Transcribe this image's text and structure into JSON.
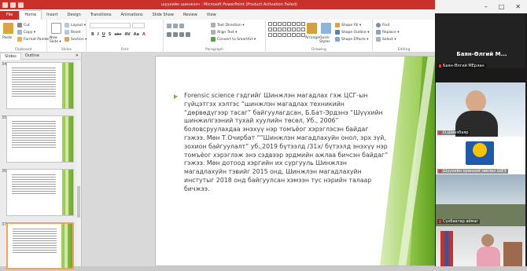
{
  "window": {
    "title": "шуухийн шинжээч - Microsoft PowerPoint (Product Activation Failed)",
    "top_controls": [
      "–",
      "□",
      "✕"
    ]
  },
  "ribbon": {
    "tabs": [
      "File",
      "Home",
      "Insert",
      "Design",
      "Transitions",
      "Animations",
      "Slide Show",
      "Review",
      "View"
    ],
    "clipboard": {
      "paste": "Paste",
      "cut": "Cut",
      "copy": "Copy ▾",
      "format_painter": "Format Painter",
      "label": "Clipboard"
    },
    "slides": {
      "new_slide": "New Slide ▾",
      "layout": "Layout ▾",
      "reset": "Reset",
      "section": "Section ▾",
      "label": "Slides"
    },
    "font": {
      "label": "Font",
      "buttons": [
        "B",
        "I",
        "U",
        "S",
        "abc",
        "AV",
        "Aa",
        "A"
      ]
    },
    "paragraph": {
      "text_direction": "Text Direction ▾",
      "align_text": "Align Text ▾",
      "convert": "Convert to SmartArt ▾",
      "label": "Paragraph"
    },
    "drawing": {
      "arrange": "Arrange",
      "quick_styles": "Quick Styles",
      "shape_fill": "Shape Fill ▾",
      "shape_outline": "Shape Outline ▾",
      "shape_effects": "Shape Effects ▾",
      "label": "Drawing"
    },
    "editing": {
      "find": "Find",
      "replace": "Replace ▾",
      "select": "Select ▾",
      "label": "Editing"
    }
  },
  "slides_pane": {
    "tabs": [
      "Slides",
      "Outline"
    ],
    "close": "✕",
    "thumbnails": [
      {
        "number": "34"
      },
      {
        "number": "35"
      },
      {
        "number": "36"
      },
      {
        "number": "37",
        "selected": true
      }
    ]
  },
  "slide": {
    "body": "Forensic science гэдгийг Шинжлэн магадлах гэж ЦСГ-ын гүйцэтгэх хэлтэс “шинжлэн магадлах техникийн “дөрвөдүгээр тасаг” байгуулагдсан, Б.Бат-Эрдэнэ “Шүүхийн шинжилгээний тухай хуулийн төсөл, Уб., 2006” боловсруулахдаа энэхүү нэр томъёог хэрэглэсэн байдаг гэжээ. Мөн Т.Очирбат “”Шинжлэн магадлахуйн онол, эрх зүй, зохион байгуулалт” уб.,2019 бүтээлд /31x/ бүтээлд энэхүү нэр томъёог хэрэглэж энэ сэдвээр эрдмийн ажлаа бичсэн байдаг” гэжээ. Мөн дотоод хэргийн их сургууль Шинжлэн магадлахуйн тэвийг 2015 онд, Шинжлэн магадлахуйн инстутыг 2018 онд байгуулсан хэмээн тус нэрийн талаар бичжээ."
  },
  "meeting": {
    "active_speaker": "Баян-Өлгий М...",
    "participants": [
      "Баян-Өлгий МЕрлан",
      "О.Шинэбаяр",
      "Шүүхийн ерөнхий зөвлөл ШЕЗ",
      "Сүхбаатар аймаг",
      ""
    ]
  },
  "colors": {
    "accent": "#c8302b",
    "slide_green": "#8cc542",
    "bullet": "#7bb83a"
  }
}
